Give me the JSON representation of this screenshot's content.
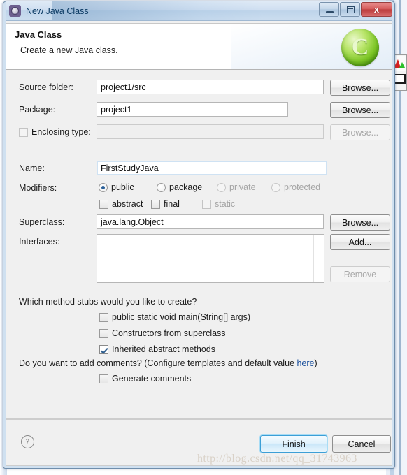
{
  "window": {
    "title": "New Java Class",
    "icon": "java-class-wizard-icon",
    "minimize_label": "",
    "maximize_label": "",
    "close_label": "x"
  },
  "header": {
    "title": "Java Class",
    "subtitle": "Create a new Java class.",
    "icon": "C"
  },
  "form": {
    "source_folder": {
      "label": "Source folder:",
      "value": "project1/src",
      "browse": "Browse..."
    },
    "package": {
      "label": "Package:",
      "value": "project1",
      "browse": "Browse..."
    },
    "enclosing_type": {
      "label": "Enclosing type:",
      "checked": false,
      "value": "",
      "browse": "Browse...",
      "disabled": true
    },
    "name": {
      "label": "Name:",
      "value": "FirstStudyJava"
    },
    "modifiers": {
      "label": "Modifiers:",
      "radios": [
        {
          "label": "public",
          "selected": true,
          "disabled": false
        },
        {
          "label": "package",
          "selected": false,
          "disabled": false
        },
        {
          "label": "private",
          "selected": false,
          "disabled": true
        },
        {
          "label": "protected",
          "selected": false,
          "disabled": true
        }
      ],
      "checkboxes": [
        {
          "label": "abstract",
          "checked": false,
          "disabled": false
        },
        {
          "label": "final",
          "checked": false,
          "disabled": false
        },
        {
          "label": "static",
          "checked": false,
          "disabled": true
        }
      ]
    },
    "superclass": {
      "label": "Superclass:",
      "value": "java.lang.Object",
      "browse": "Browse..."
    },
    "interfaces": {
      "label": "Interfaces:",
      "items": [],
      "add": "Add...",
      "remove": "Remove"
    }
  },
  "stubs": {
    "question": "Which method stubs would you like to create?",
    "options": [
      {
        "label": "public static void main(String[] args)",
        "checked": false
      },
      {
        "label": "Constructors from superclass",
        "checked": false
      },
      {
        "label": "Inherited abstract methods",
        "checked": true
      }
    ]
  },
  "comments": {
    "question_prefix": "Do you want to add comments? (Configure templates and default value ",
    "link": "here",
    "question_suffix": ")",
    "option": {
      "label": "Generate comments",
      "checked": false
    }
  },
  "footer": {
    "help": "?",
    "finish": "Finish",
    "cancel": "Cancel"
  },
  "watermark": "http://blog.csdn.net/qq_31743963"
}
